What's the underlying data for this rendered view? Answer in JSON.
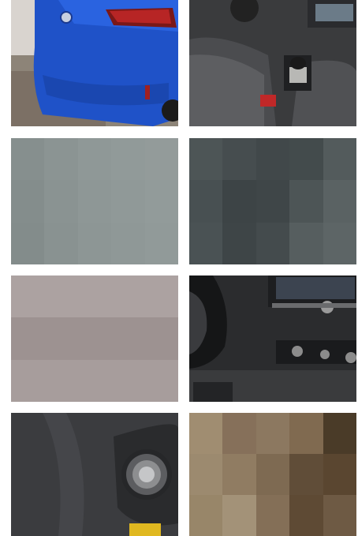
{
  "gallery": {
    "photos": [
      {
        "name": "rear-blue-hatchback",
        "alt": ""
      },
      {
        "name": "interior-gear-shift",
        "alt": ""
      },
      {
        "name": "blurred-gray-1",
        "alt": ""
      },
      {
        "name": "blurred-dark-gray",
        "alt": ""
      },
      {
        "name": "blurred-mauve",
        "alt": ""
      },
      {
        "name": "dashboard-steering-wheel",
        "alt": ""
      },
      {
        "name": "light-switch-panel",
        "alt": ""
      },
      {
        "name": "blurred-brown",
        "alt": ""
      }
    ]
  }
}
